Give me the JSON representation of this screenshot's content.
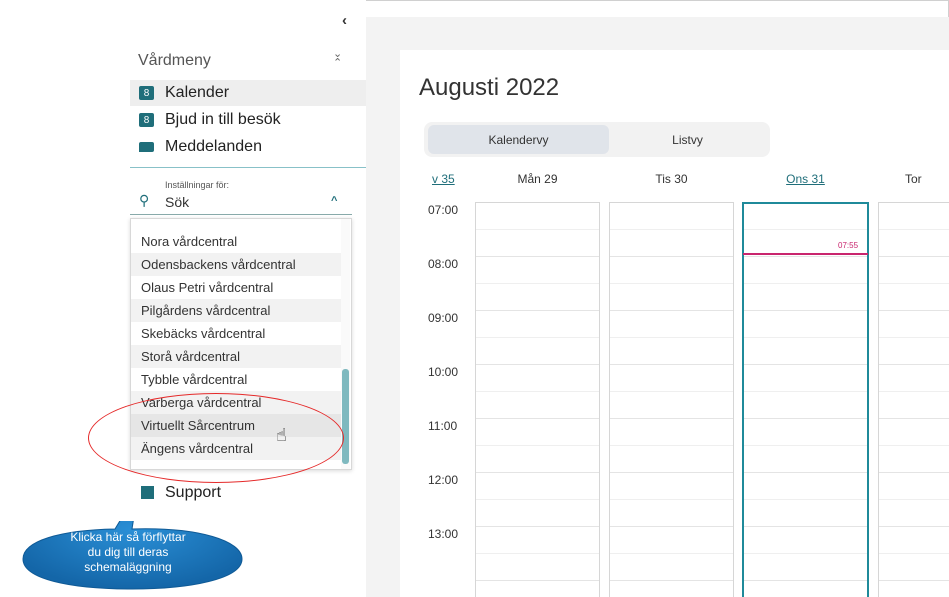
{
  "sidebar": {
    "collapse_icon": "‹",
    "menu_title": "Vårdmeny",
    "items": [
      {
        "label": "Kalender",
        "icon": "calendar-icon",
        "icon_glyph": "8"
      },
      {
        "label": "Bjud in till besök",
        "icon": "invite-icon",
        "icon_glyph": "8"
      },
      {
        "label": "Meddelanden",
        "icon": "message-icon",
        "icon_glyph": ""
      }
    ],
    "settings_label": "Inställningar för:",
    "search_value": "Sök",
    "dropdown_items": [
      "Nora vårdcentral",
      "Odensbackens vårdcentral",
      "Olaus Petri vårdcentral",
      "Pilgårdens vårdcentral",
      "Skebäcks vårdcentral",
      "Storå vårdcentral",
      "Tybble vårdcentral",
      "Varberga vårdcentral",
      "Virtuellt Sårcentrum",
      "Ängens vårdcentral"
    ],
    "support_label": "Support"
  },
  "callout": {
    "text_line1": "Klicka här så förflyttar",
    "text_line2": "du dig till deras",
    "text_line3": "schemaläggning"
  },
  "calendar": {
    "month_title": "Augusti 2022",
    "tabs": [
      "Kalendervy",
      "Listvy"
    ],
    "week_label": "v 35",
    "days": [
      "Mån 29",
      "Tis 30",
      "Ons 31",
      "Tor"
    ],
    "times": [
      "07:00",
      "08:00",
      "09:00",
      "10:00",
      "11:00",
      "12:00",
      "13:00"
    ],
    "now_time": "07:55"
  },
  "colors": {
    "accent": "#1f6e7a",
    "now_line": "#c9256e",
    "annotation": "#e52a2a",
    "callout": "#1a7cc4"
  }
}
